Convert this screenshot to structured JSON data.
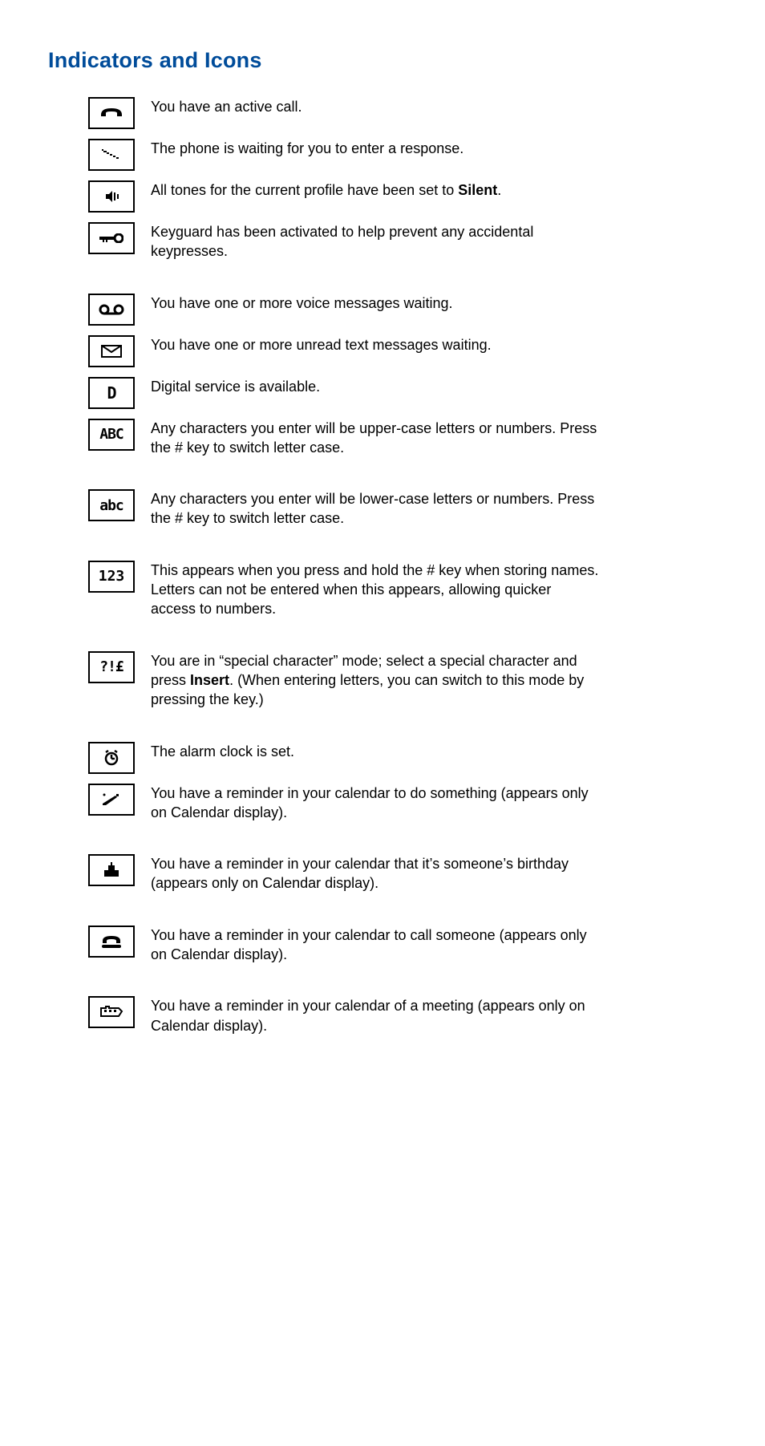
{
  "title": "Indicators and Icons",
  "icons": {
    "active_call": "active-call-icon",
    "waiting_response": "waiting-response-icon",
    "silent": "silent-icon",
    "keyguard": "keyguard-icon",
    "voicemail": "voicemail-icon",
    "unread_text": "unread-text-icon",
    "digital_service": "digital-service-icon",
    "abc_upper": "ABC",
    "abc_lower": "abc",
    "numbers": "123",
    "special_chars": "?!£",
    "alarm": "alarm-icon",
    "reminder_todo": "reminder-todo-icon",
    "reminder_birthday": "reminder-birthday-icon",
    "reminder_call": "reminder-call-icon",
    "reminder_meeting": "reminder-meeting-icon"
  },
  "rows": {
    "active_call": "You have an active call.",
    "waiting_response": "The phone is waiting for you to enter a response.",
    "silent_pre": "All tones for the current profile have been set to ",
    "silent_bold": "Silent",
    "silent_post": ".",
    "keyguard": "Keyguard has been activated to help prevent any accidental keypresses.",
    "voicemail": "You have one or more voice messages waiting.",
    "unread_text": "You have one or more unread text messages waiting.",
    "digital_service": "Digital service is available.",
    "abc_upper": "Any characters you enter will be upper-case letters or numbers. Press the # key to switch letter case.",
    "abc_lower": "Any characters you enter will be lower-case letters or numbers. Press the # key to switch letter case.",
    "numbers": "This appears when you press and hold the # key when storing names. Letters can not be entered when this appears, allowing quicker access to numbers.",
    "special_pre": "You are in “special character” mode; select a special character and press ",
    "special_bold": "Insert",
    "special_post": ". (When entering letters, you can switch to this mode by pressing the    key.)",
    "alarm": "The alarm clock is set.",
    "reminder_todo": "You have a reminder in your calendar to do something (appears only on Calendar display).",
    "reminder_birthday": "You have a reminder in your calendar that it’s someone’s birthday (appears only on Calendar display).",
    "reminder_call": "You have a reminder in your calendar to call someone (appears only on Calendar display).",
    "reminder_meeting": "You have a reminder in your calendar of a meeting (appears only on Calendar display)."
  }
}
